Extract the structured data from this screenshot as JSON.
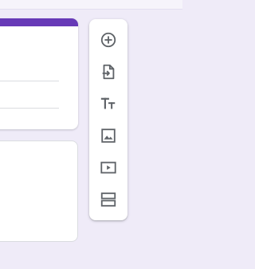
{
  "colors": {
    "background": "#efebf8",
    "accent": "#673ab7",
    "icon": "#5f6368",
    "card": "#ffffff"
  },
  "toolbar": {
    "items": [
      {
        "icon": "add-circle-icon",
        "label": ""
      },
      {
        "icon": "import-icon",
        "label": ""
      },
      {
        "icon": "title-text-icon",
        "label": ""
      },
      {
        "icon": "image-icon",
        "label": ""
      },
      {
        "icon": "video-icon",
        "label": ""
      },
      {
        "icon": "section-icon",
        "label": ""
      }
    ]
  }
}
